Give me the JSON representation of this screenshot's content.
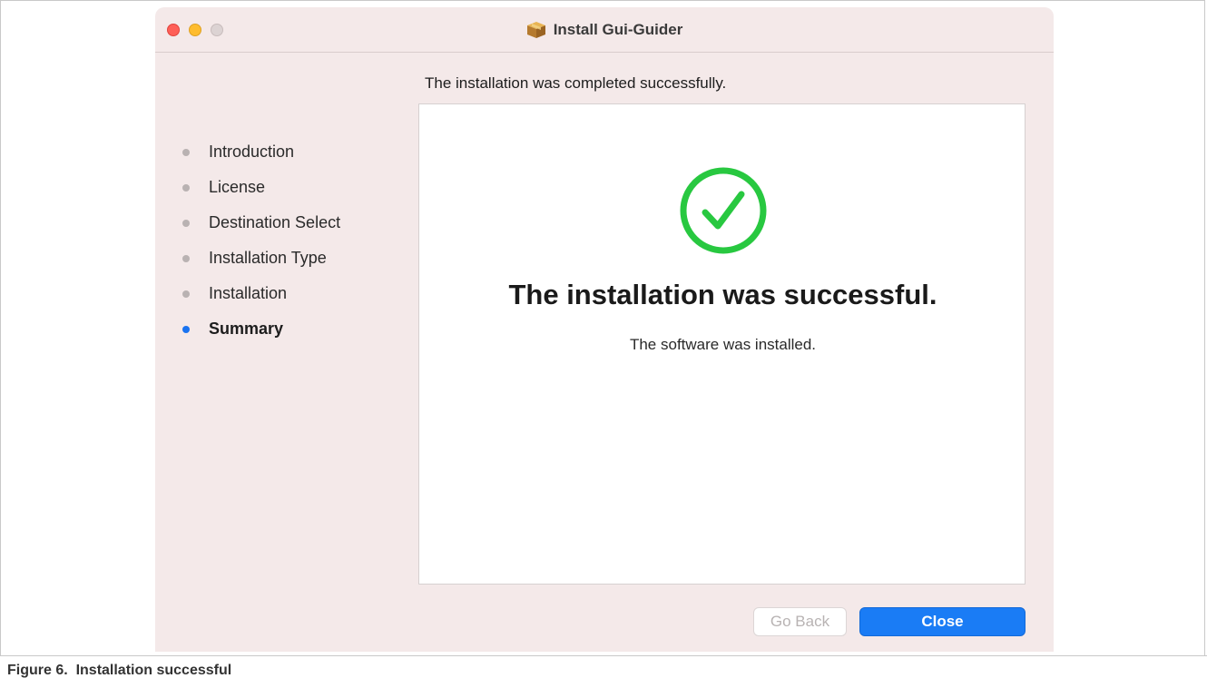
{
  "window": {
    "title": "Install Gui-Guider",
    "title_icon": "package-icon"
  },
  "header": {
    "headline": "The installation was completed successfully."
  },
  "sidebar": {
    "items": [
      {
        "label": "Introduction",
        "active": false
      },
      {
        "label": "License",
        "active": false
      },
      {
        "label": "Destination Select",
        "active": false
      },
      {
        "label": "Installation Type",
        "active": false
      },
      {
        "label": "Installation",
        "active": false
      },
      {
        "label": "Summary",
        "active": true
      }
    ]
  },
  "main": {
    "status_icon": "success-checkmark-icon",
    "title": "The installation was successful.",
    "subtitle": "The software was installed."
  },
  "footer": {
    "back_label": "Go Back",
    "back_enabled": false,
    "close_label": "Close"
  },
  "caption": {
    "text": "Figure 6.  Installation successful"
  },
  "colors": {
    "window_bg": "#f4e9e9",
    "accent": "#1a7cf5",
    "success": "#28c840"
  }
}
